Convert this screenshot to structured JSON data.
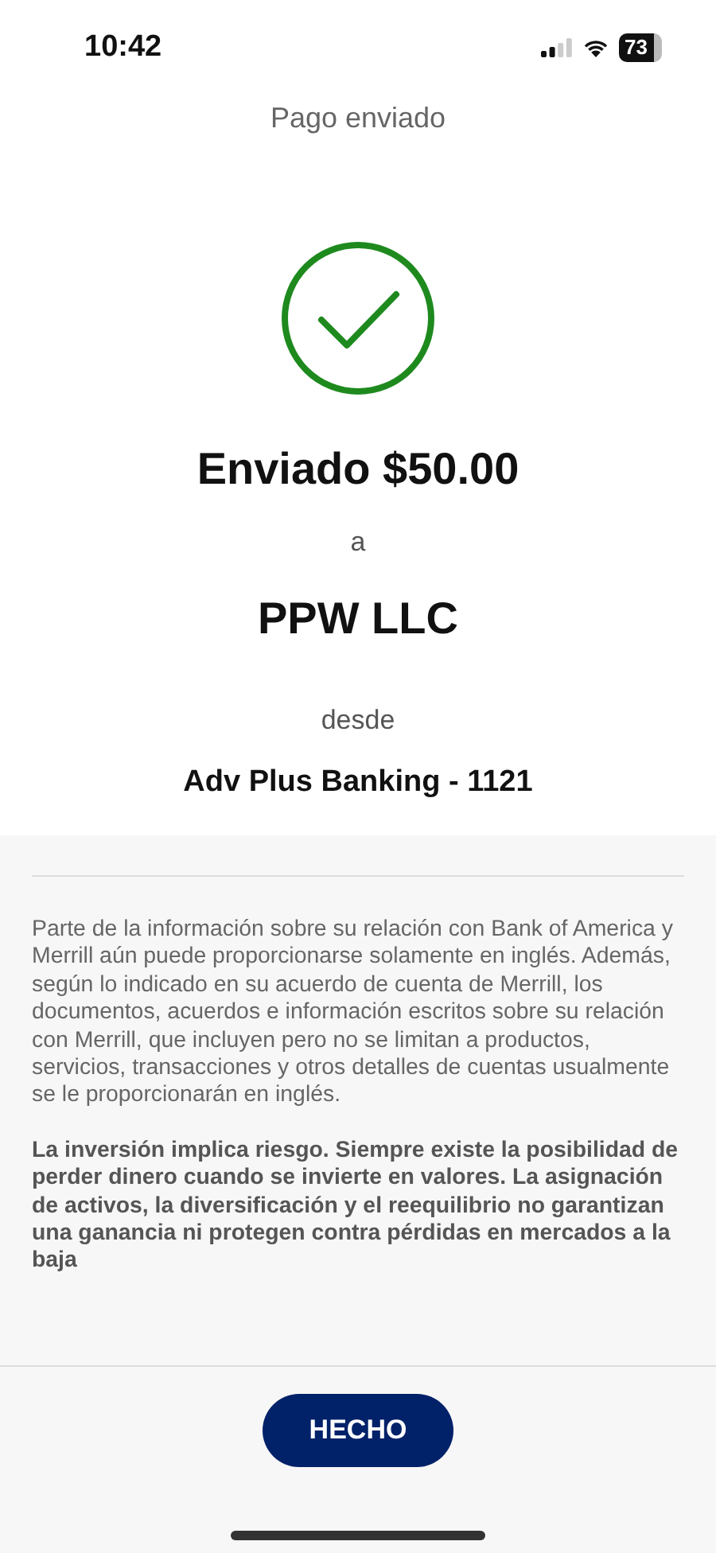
{
  "status_bar": {
    "time": "10:42",
    "battery": "73"
  },
  "header": {
    "title": "Pago enviado"
  },
  "confirmation": {
    "amount_line": "Enviado $50.00",
    "to_label": "a",
    "payee": "PPW LLC",
    "from_label": "desde",
    "account": "Adv Plus Banking - 1121"
  },
  "disclosures": [
    {
      "kind": "normal",
      "text": "Parte de la información sobre su relación con Bank of America y Merrill aún puede proporcionarse solamente en inglés. Además, según lo indicado en su acuerdo de cuenta de Merrill, los documentos, acuerdos e información escritos sobre su relación con Merrill, que incluyen pero no se limitan a productos, servicios, transacciones y otros detalles de cuentas usualmente se le proporcionarán en inglés."
    },
    {
      "kind": "bold",
      "text": "La inversión implica riesgo. Siempre existe la posibilidad de perder dinero cuando se invierte en valores. La asignación de activos, la diversificación y el reequilibrio no garantizan una ganancia ni protegen contra pérdidas en mercados a la baja"
    }
  ],
  "footer": {
    "button": "HECHO"
  }
}
